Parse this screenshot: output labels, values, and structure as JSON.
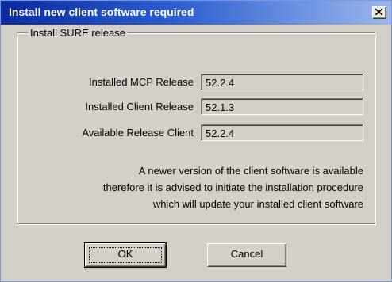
{
  "window": {
    "title": "Install new client software required",
    "close_icon": "close-x-icon"
  },
  "group": {
    "legend": "Install SURE release",
    "fields": [
      {
        "label": "Installed MCP Release",
        "value": "52.2.4"
      },
      {
        "label": "Installed Client Release",
        "value": "52.1.3"
      },
      {
        "label": "Available Release Client",
        "value": "52.2.4"
      }
    ],
    "message_lines": [
      "A newer version of the client software is available",
      "therefore it is advised to initiate the installation procedure",
      "which will update your installed client software"
    ]
  },
  "buttons": {
    "ok_label": "OK",
    "cancel_label": "Cancel"
  },
  "colors": {
    "titlebar_start": "#0a2a9e",
    "titlebar_end": "#9bb7ec",
    "face": "#d4d0c8"
  }
}
